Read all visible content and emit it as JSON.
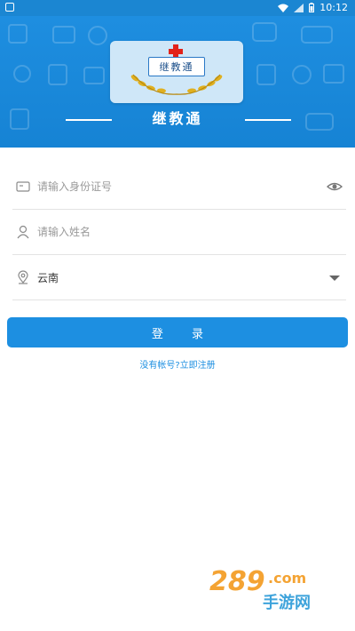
{
  "status_bar": {
    "time": "10:12",
    "icons": [
      "notification-icon",
      "wifi-icon",
      "signal-icon",
      "battery-icon"
    ]
  },
  "header": {
    "logo_text": "继教通",
    "brand_title": "继教通"
  },
  "form": {
    "id_field": {
      "placeholder": "请输入身份证号",
      "value": "",
      "icon": "id-card-icon",
      "trailing_icon": "eye-icon"
    },
    "name_field": {
      "placeholder": "请输入姓名",
      "value": "",
      "icon": "person-icon"
    },
    "region_field": {
      "value": "云南",
      "icon": "location-icon",
      "trailing_icon": "dropdown-arrow-icon"
    }
  },
  "login_button": {
    "label": "登 录"
  },
  "register_link": {
    "label": "没有帐号?立即注册"
  },
  "watermark": {
    "text_top": "289.com",
    "text_bottom": "手游网"
  },
  "colors": {
    "primary": "#1d8fe1",
    "banner": "#1683d4",
    "divider": "#e3e3e3",
    "placeholder": "#9a9a9a"
  }
}
